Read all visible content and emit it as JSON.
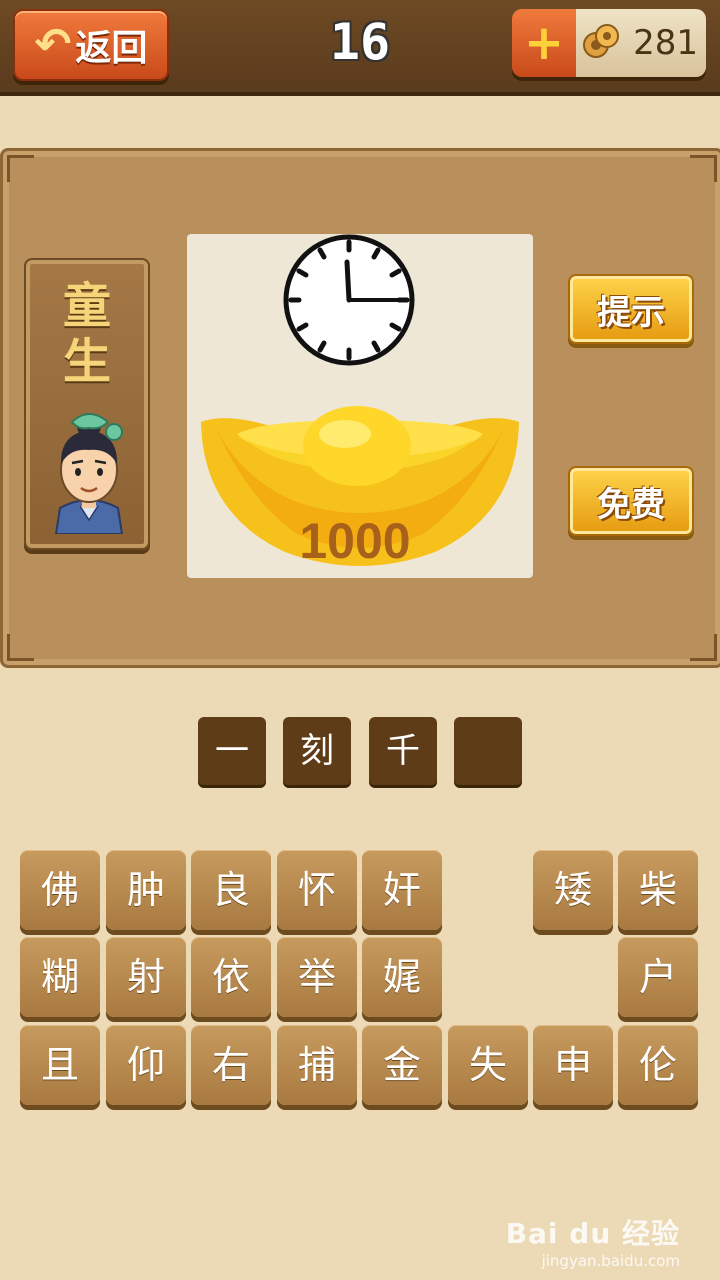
{
  "header": {
    "back_label": "返回",
    "level": "16",
    "coins": "281",
    "add_symbol": "+"
  },
  "character": {
    "name": "童\n生"
  },
  "puzzle": {
    "clock_time": "3:00",
    "ingot_text": "1000"
  },
  "actions": {
    "hint_label": "提示",
    "free_label": "免费"
  },
  "answer": [
    "一",
    "刻",
    "千",
    ""
  ],
  "tiles": [
    [
      "佛",
      "肿",
      "良",
      "怀",
      "奸",
      "",
      "矮",
      "柴"
    ],
    [
      "糊",
      "射",
      "依",
      "举",
      "娓",
      "",
      "",
      "户"
    ],
    [
      "且",
      "仰",
      "右",
      "捕",
      "金",
      "失",
      "申",
      "伦"
    ]
  ],
  "watermark": {
    "brand": "Bai du 经验",
    "url": "jingyan.baidu.com"
  }
}
